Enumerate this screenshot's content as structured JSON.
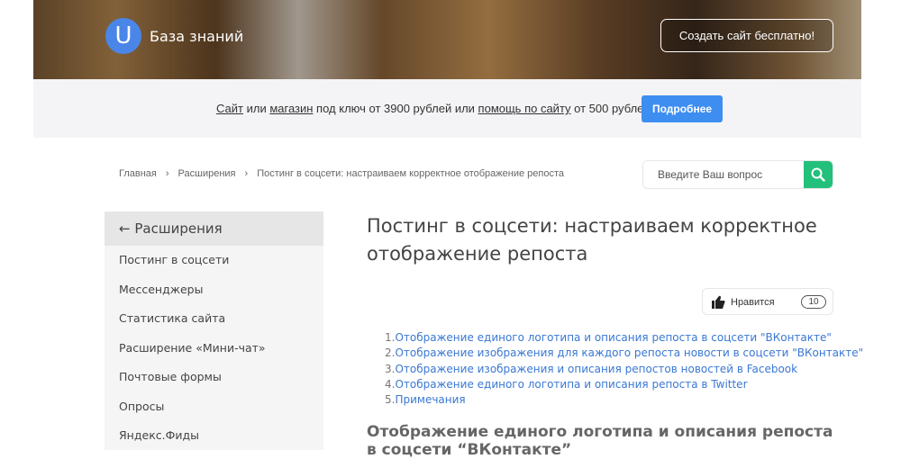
{
  "header": {
    "logo_letter": "U",
    "brand": "База знаний",
    "cta": "Создать сайт бесплатно!"
  },
  "promo": {
    "link1": "Сайт",
    "t1": " или ",
    "link2": "магазин",
    "t2": " под ключ от 3900 рублей или ",
    "link3": "помощь по сайту",
    "t3": " от 500 рублей.",
    "button": "Подробнее"
  },
  "breadcrumbs": [
    "Главная",
    "Расширения",
    "Постинг в соцсети: настраиваем корректное отображение репоста"
  ],
  "breadcrumb_sep": "›",
  "search": {
    "placeholder": "Введите Ваш вопрос"
  },
  "sidebar": {
    "back_icon": "←",
    "title": "Расширения",
    "items": [
      "Постинг в соцсети",
      "Мессенджеры",
      "Статистика сайта",
      "Расширение «Мини-чат»",
      "Почтовые формы",
      "Опросы",
      "Яндекс.Фиды"
    ]
  },
  "article": {
    "title": "Постинг в соцсети: настраиваем корректное отображение репоста",
    "like": {
      "label": "Нравится",
      "count": "10"
    },
    "toc": [
      {
        "n": "1.",
        "t": "Отображение единого логотипа и описания репоста в соцсети \"ВКонтакте\""
      },
      {
        "n": "2.",
        "t": "Отображение изображения для каждого репоста новости в соцсети \"ВКонтакте\""
      },
      {
        "n": "3.",
        "t": "Отображение изображения и описания репостов новостей в Facebook"
      },
      {
        "n": "4.",
        "t": "Отображение единого логотипа и описания репоста в Twitter"
      },
      {
        "n": "5.",
        "t": "Примечания"
      }
    ],
    "section_title": "Отображение единого логотипа и описания репоста в соцсети “ВКонтакте”"
  },
  "colors": {
    "accent": "#3d8ef0",
    "search": "#22c07a",
    "link": "#3a78d4"
  }
}
